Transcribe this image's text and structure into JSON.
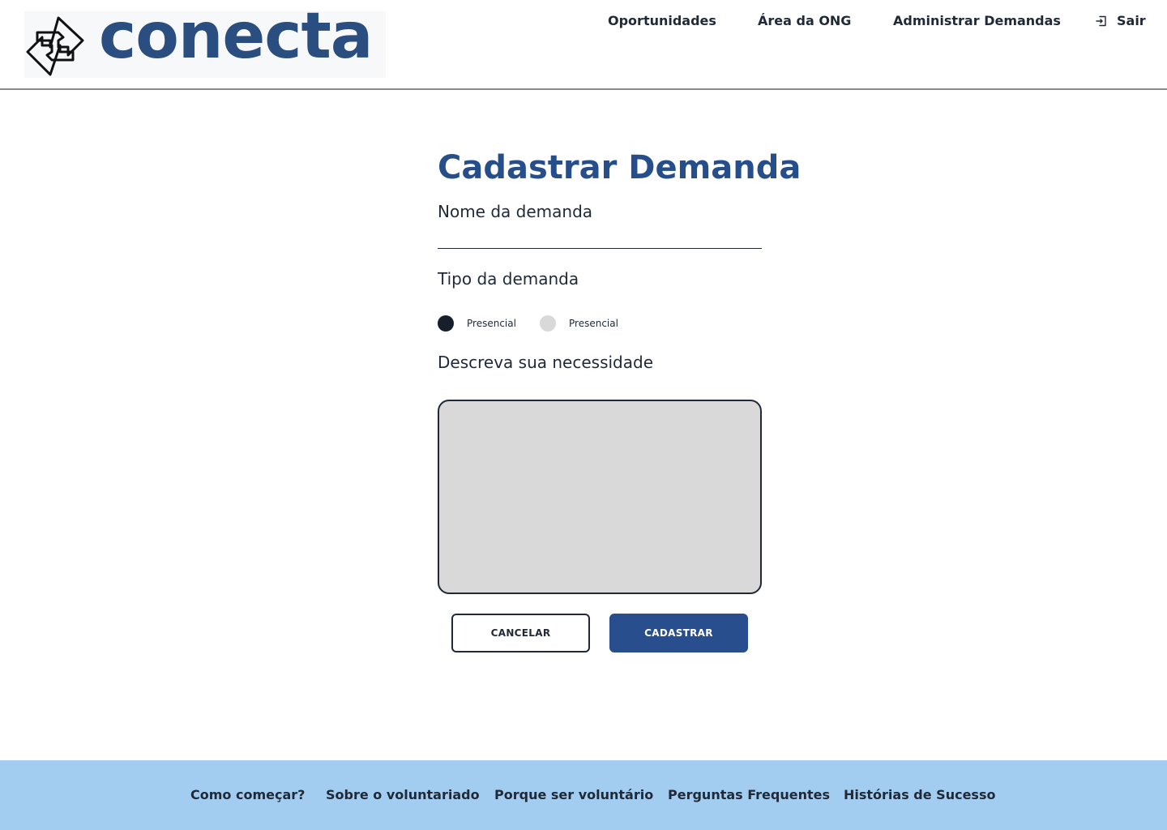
{
  "header": {
    "logo_text": "conecta",
    "logo_icon": "swap-arrows-icon",
    "nav": {
      "oportunidades": "Oportunidades",
      "area_ong": "Área da ONG",
      "administrar": "Administrar Demandas",
      "sair": "Sair",
      "sair_icon": "exit-icon"
    }
  },
  "form": {
    "title": "Cadastrar Demanda",
    "name_label": "Nome da demanda",
    "name_value": "",
    "type_label": "Tipo da demanda",
    "type_options": [
      {
        "label": "Presencial",
        "selected": true
      },
      {
        "label": "Presencial",
        "selected": false
      }
    ],
    "description_label": "Descreva sua necessidade",
    "description_value": "",
    "cancel_label": "CANCELAR",
    "submit_label": "CADASTRAR"
  },
  "footer": {
    "links": [
      "Como começar?",
      "Sobre o voluntariado",
      "Porque ser voluntário",
      "Perguntas Frequentes",
      "Histórias de Sucesso"
    ]
  },
  "colors": {
    "brand_blue": "#264e8b",
    "logo_blue": "#2a4e7f",
    "button_blue": "#284e8e",
    "footer_bg": "#a3cdf0",
    "textarea_bg": "#d9d9d9"
  }
}
